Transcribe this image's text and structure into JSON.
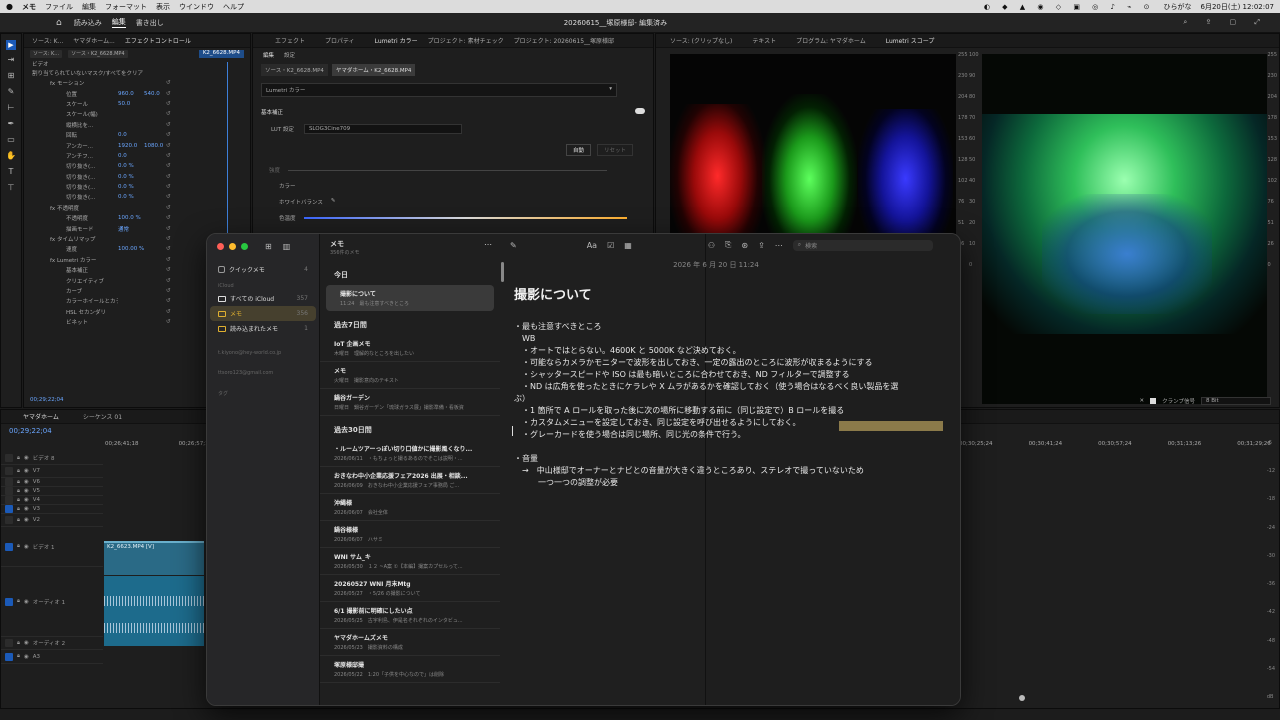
{
  "menubar": {
    "apple": "",
    "app": "メモ",
    "items": [
      "ファイル",
      "編集",
      "フォーマット",
      "表示",
      "ウインドウ",
      "ヘルプ"
    ],
    "ime": "ひらがな",
    "date": "6月20日(土) 12:02:07"
  },
  "premiere": {
    "workspace_tabs": [
      "読み込み",
      "編集",
      "書き出し"
    ],
    "project_title": "20260615__塚原様邸- 編集済み",
    "left_tabs": [
      "ソース: K...",
      "ヤマダホーム...",
      "エフェクトコントロール"
    ],
    "ec_header_clip": "ソース・K2_6628.MP4",
    "ec_clip_label": "K2_6628.MP4",
    "ec_video": "ビデオ",
    "ec_mask": "割り当てられていないマスク/すべてをクリア",
    "ec_rows": [
      {
        "label": "fx モーション",
        "v1": "",
        "v2": ""
      },
      {
        "label": "位置",
        "v1": "960.0",
        "v2": "540.0"
      },
      {
        "label": "スケール",
        "v1": "50.0",
        "v2": ""
      },
      {
        "label": "スケール(幅)",
        "v1": "",
        "v2": ""
      },
      {
        "label": "縦横比を...",
        "v1": "",
        "v2": ""
      },
      {
        "label": "回転",
        "v1": "0.0",
        "v2": ""
      },
      {
        "label": "アンカー...",
        "v1": "1920.0",
        "v2": "1080.0"
      },
      {
        "label": "アンチフ...",
        "v1": "0.0",
        "v2": ""
      },
      {
        "label": "切り抜き(...",
        "v1": "0.0 %",
        "v2": ""
      },
      {
        "label": "切り抜き(...",
        "v1": "0.0 %",
        "v2": ""
      },
      {
        "label": "切り抜き(...",
        "v1": "0.0 %",
        "v2": ""
      },
      {
        "label": "切り抜き(...",
        "v1": "0.0 %",
        "v2": ""
      },
      {
        "label": "fx 不透明度",
        "v1": "",
        "v2": ""
      },
      {
        "label": "不透明度",
        "v1": "100.0 %",
        "v2": ""
      },
      {
        "label": "描画モード",
        "v1": "通常",
        "v2": ""
      },
      {
        "label": "fx タイムリマップ",
        "v1": "",
        "v2": ""
      },
      {
        "label": "速度",
        "v1": "100.00 %",
        "v2": ""
      },
      {
        "label": "fx Lumetri カラー",
        "v1": "",
        "v2": ""
      },
      {
        "label": "基本補正",
        "v1": "",
        "v2": ""
      },
      {
        "label": "クリエイティブ",
        "v1": "",
        "v2": ""
      },
      {
        "label": "カーブ",
        "v1": "",
        "v2": ""
      },
      {
        "label": "カラーホイールとカラーマッチ",
        "v1": "",
        "v2": ""
      },
      {
        "label": "HSL セカンダリ",
        "v1": "",
        "v2": ""
      },
      {
        "label": "ビネット",
        "v1": "",
        "v2": ""
      }
    ],
    "ec_timecode": "00;29;22;04",
    "mid_tabs": [
      "エフェクト",
      "プロパティ",
      "Lumetri カラー",
      "プロジェクト: 素材チェック",
      "プロジェクト: 20260615__塚原様邸"
    ],
    "lumetri_subtabs": [
      "編集",
      "設定"
    ],
    "lumetri_clip_tabs": [
      "ソース・K2_6628.MP4",
      "ヤマダホーム・K2_6628.MP4"
    ],
    "lumetri_effect": "Lumetri カラー",
    "lumetri_basic": "基本補正",
    "lut_label": "LUT 設定",
    "lut_value": "SLOG3Cine709",
    "auto_label": "自動",
    "reset_label": "リセット",
    "intensity_label": "強度",
    "color_label": "カラー",
    "wb_label": "ホワイトバランス",
    "temp_label": "色温度",
    "right_tabs": [
      "ソース: (クリップなし)",
      "テキスト",
      "プログラム: ヤマダホーム",
      "Lumetri スコープ"
    ],
    "scope_scale_left": [
      "255",
      "230",
      "204",
      "178",
      "153",
      "128",
      "102",
      "76",
      "51",
      "26",
      "0"
    ],
    "scope_scale_mid": [
      "100",
      "90",
      "80",
      "70",
      "60",
      "50",
      "40",
      "30",
      "20",
      "10",
      "0"
    ],
    "scope_clamp": "クランプ信号",
    "scope_bits": "8 Bit",
    "tl_tabs": [
      "ヤマダホーム",
      "シーケンス 01"
    ],
    "tl_timecode": "00;29;22;04",
    "tl_ruler_left": [
      "00;26;41;18",
      "00;26;57;18"
    ],
    "tl_ruler_right": [
      "00;30;25;24",
      "00;30;41;24",
      "00;30;57;24",
      "00;31;13;26",
      "00;31;29;26"
    ],
    "tracks": [
      "ビデオ 8",
      "V7",
      "V6",
      "V5",
      "V4",
      "V3",
      "V2",
      "ビデオ 1",
      "オーディオ 1",
      "オーディオ 2",
      "A3"
    ],
    "clip_label": "K2_6623.MP4 [V]",
    "db_scale": [
      "-6",
      "-12",
      "-18",
      "-24",
      "-30",
      "-36",
      "-42",
      "-48",
      "-54",
      "dB"
    ]
  },
  "notes": {
    "sidebar": {
      "quick": "クイックメモ",
      "quick_count": "4",
      "icloud": "iCloud",
      "folders": [
        {
          "name": "すべての iCloud",
          "count": "357"
        },
        {
          "name": "メモ",
          "count": "356"
        },
        {
          "name": "読み込まれたメモ",
          "count": "1"
        }
      ],
      "accounts": [
        "t.kiyono@hey-world.co.jp",
        "ttsoro123@gmail.com",
        "タグ"
      ]
    },
    "list": {
      "title": "メモ",
      "subtitle": "356件のメモ",
      "groups": [
        {
          "label": "今日",
          "items": [
            {
              "title": "撮影について",
              "meta": "11:24　最も注意すべきところ"
            }
          ]
        },
        {
          "label": "過去7日間",
          "items": [
            {
              "title": "IoT 企画メモ",
              "meta": "木曜日　理解的なところを出したい"
            },
            {
              "title": "メモ",
              "meta": "火曜日　撮影意向のテキスト"
            },
            {
              "title": "鍋谷ガーデン",
              "meta": "日曜日　鍋谷ガーデン「琉球ガラス展」撮影準備・看板資"
            }
          ]
        },
        {
          "label": "過去30日間",
          "items": [
            {
              "title": "・ルームツアーっぽい切り口値かに撮影風くなり...",
              "meta": "2026/06/11　・もちょっと撮るあるのでそこは説明・..."
            },
            {
              "title": "おきなわ中小企業応援フェア2026 出展・相談...",
              "meta": "2026/06/09　おきなわ中小企業応援フェア事務局 ご..."
            },
            {
              "title": "沖縄様",
              "meta": "2026/06/07　会社全体"
            },
            {
              "title": "鍋谷様様",
              "meta": "2026/06/07　ハサミ"
            },
            {
              "title": "WNI サム_キ",
              "meta": "2026/05/30　１２ ~A案 ①【本編】撮案カプセルって..."
            },
            {
              "title": "20260527 WNI 月末Mtg",
              "meta": "2026/05/27　・5/26 の撮影について"
            },
            {
              "title": "6/1 撮影前に明確にしたい点",
              "meta": "2026/05/25　古宇利島、伊是名それぞれのインタビュ..."
            },
            {
              "title": "ヤマダホームズメモ",
              "meta": "2026/05/23　撮影資料の構成"
            },
            {
              "title": "塚原様邸撮",
              "meta": "2026/05/22　1:20「子供を中心なので」は削除"
            }
          ]
        }
      ]
    },
    "editor": {
      "date": "2026 年 6 月 20 日 11:24",
      "heading": "撮影について",
      "search_placeholder": "検索",
      "lines": [
        "・最も注意すべきところ",
        "　WB",
        "　・オートではとらない。4600K と 5000K など決めておく。",
        "　・可能ならカメラかモニターで波形を出しておき、一定の露出のところに波形が収まるようにする",
        "　・シャッタースピードや ISO は最も暗いところに合わせておき、ND フィルターで調整する",
        "　・ND は広角を使ったときにケラレや X ムラがあるかを確認しておく（使う場合はなるべく良い製品を選",
        "ぶ）",
        "　・1 箇所で A ロールを取った後に次の場所に移動する前に（同じ設定で）B ロールを撮る",
        "　・カスタムメニューを設定しておき、同じ設定を呼び出せるようにしておく。",
        "　・グレーカードを使う場合は同じ場所、同じ光の条件で行う。",
        "",
        "・音量",
        "　→　中山様邸でオーナーとナビとの音量が大きく違うところあり、ステレオで撮っていないため",
        "　　　一つ一つの調整が必要"
      ]
    }
  }
}
